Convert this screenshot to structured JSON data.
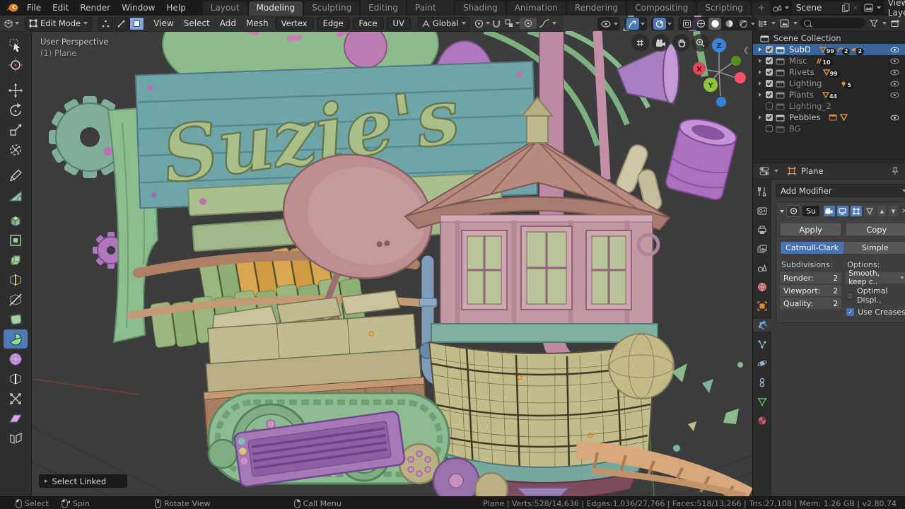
{
  "topbar": {
    "menus": [
      "File",
      "Edit",
      "Render",
      "Window",
      "Help"
    ],
    "tabs": [
      "Layout",
      "Modeling",
      "Sculpting",
      "UV Editing",
      "Texture Paint",
      "Shading",
      "Animation",
      "Rendering",
      "Compositing",
      "Scripting"
    ],
    "active_tab": "Modeling",
    "add_tab": "+",
    "scene": "Scene",
    "view_layer": "View Layer",
    "close_glyph": "×"
  },
  "tool_header": {
    "mode": "Edit Mode",
    "menus": [
      "View",
      "Select",
      "Add",
      "Mesh"
    ],
    "pills": [
      "Vertex",
      "Edge",
      "Face",
      "UV"
    ],
    "orientation": "Global"
  },
  "viewport": {
    "view_label": "User Perspective",
    "object_label": "(1) Plane",
    "sign_text": "Suzie's",
    "operator_label": "Select Linked",
    "operator_arrow": "▸",
    "axes": {
      "x": "X",
      "y": "Y",
      "z": "Z"
    }
  },
  "toolbar": {
    "active_tool": "spin",
    "tools": [
      "select-box",
      "cursor",
      "move",
      "rotate",
      "scale",
      "transform",
      "annotate",
      "measure",
      "extrude-region",
      "inset-faces",
      "bevel",
      "loop-cut",
      "knife",
      "poly-build",
      "spin",
      "smooth",
      "edge-slide",
      "shrink-fatten",
      "shear",
      "rip-region"
    ]
  },
  "outliner": {
    "root": "Scene Collection",
    "rows": [
      {
        "label": "SubD",
        "badges": [
          {
            "count": "99"
          },
          {
            "count": "2"
          },
          {
            "count": "2"
          }
        ]
      },
      {
        "label": "Misc",
        "badges": [
          {
            "count": "10"
          }
        ]
      },
      {
        "label": "Rivets",
        "badges": [
          {
            "count": "99"
          }
        ]
      },
      {
        "label": "Lighting",
        "badges": [
          {
            "count": "5"
          }
        ]
      },
      {
        "label": "Plants",
        "badges": [
          {
            "count": "44"
          }
        ]
      },
      {
        "label": "Lighting_2",
        "badges": []
      },
      {
        "label": "Pebbles",
        "badges": []
      },
      {
        "label": "BG",
        "badges": []
      }
    ]
  },
  "properties": {
    "object_name": "Plane",
    "add_modifier": "Add Modifier",
    "modifier": {
      "name": "Su",
      "apply": "Apply",
      "copy": "Copy",
      "algorithm_active": "Catmull-Clark",
      "algorithm_alt": "Simple",
      "subdivisions_label": "Subdivisions:",
      "options_label": "Options:",
      "render_label": "Render:",
      "render_value": "2",
      "viewport_label": "Viewport:",
      "viewport_value": "2",
      "quality_label": "Quality:",
      "quality_value": "2",
      "uv_smooth": "Smooth, keep c..",
      "optimal_display": "Optimal Displ..",
      "use_creases": "Use Creases",
      "check_glyph": "✓",
      "up_glyph": "▲",
      "down_glyph": "▼",
      "close_glyph": "×"
    }
  },
  "statusbar": {
    "hints": [
      "Select",
      "Spin",
      "Rotate View",
      "Call Menu"
    ],
    "info": "Plane | Verts:528/14,636 | Edges:1,036/27,766 | Faces:518/13,266 | Tris:27,108 | Mem: 1.26 GB | v2.80.74"
  },
  "colors": {
    "accent": "#4772b3",
    "selection": "#3a659c",
    "axis_x": "#e0455a",
    "axis_y": "#6ebe2a",
    "axis_z": "#3b83d8",
    "collection_icon": "#d98e3f"
  }
}
